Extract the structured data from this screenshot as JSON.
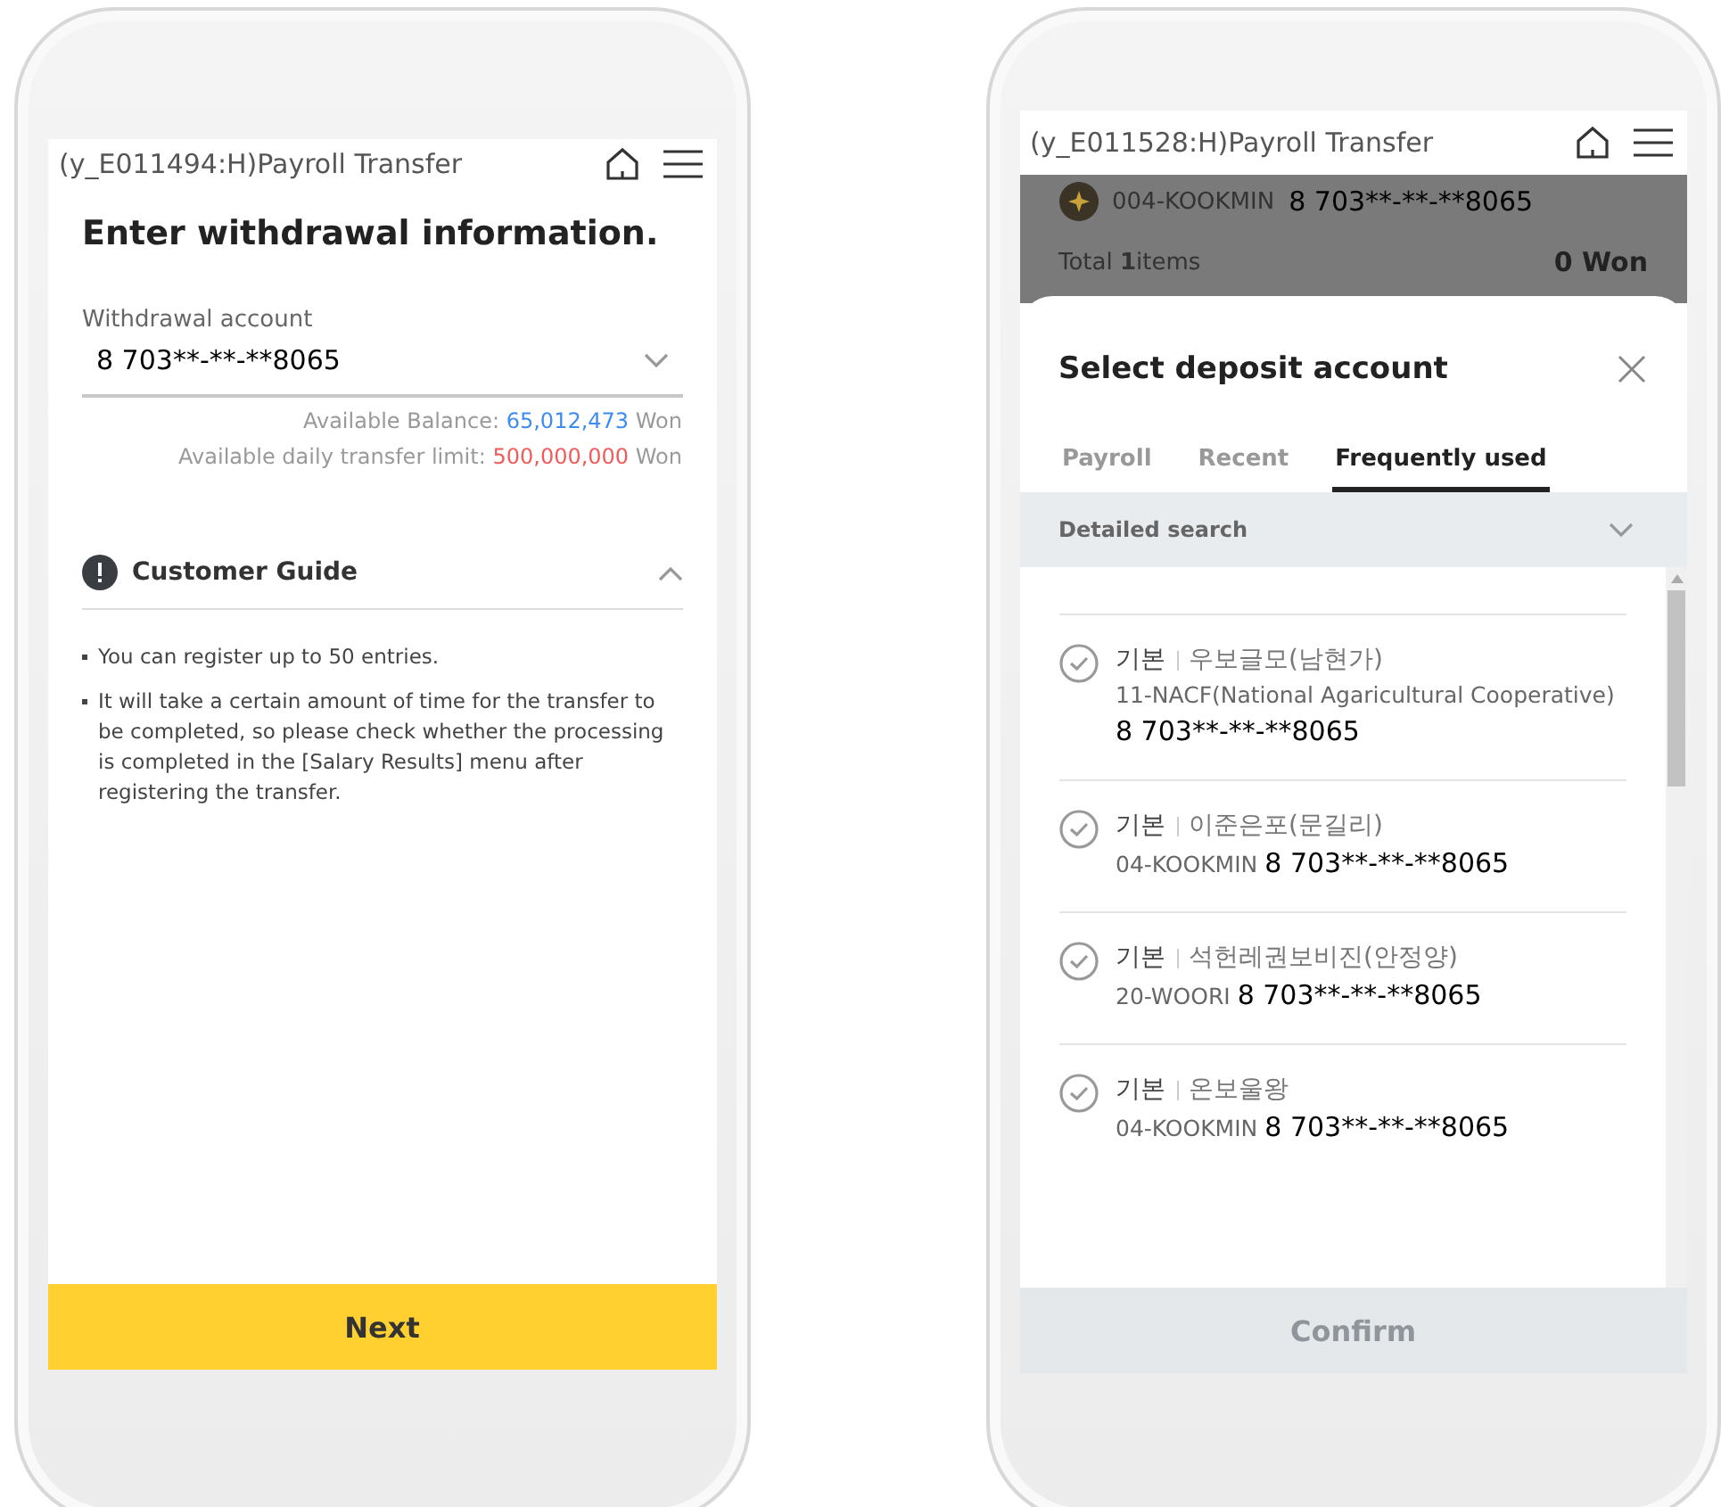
{
  "withdrawal_screen": {
    "header_title": "(y_E011494:H)Payroll Transfer",
    "title": "Enter withdrawal information.",
    "account_field": {
      "label": "Withdrawal account",
      "value": "8 703**-**-**8065"
    },
    "balance": {
      "label": "Available Balance:",
      "amount": "65,012,473",
      "unit": "Won"
    },
    "limit": {
      "label": "Available daily transfer limit:",
      "amount": "500,000,000",
      "unit": "Won"
    },
    "guide": {
      "title": "Customer Guide",
      "expanded": true,
      "items": [
        "You can register up to 50 entries.",
        "It will take a certain amount of time for the transfer to be completed, so please check whether the processing is completed in the [Salary Results] menu after registering the transfer."
      ]
    },
    "next_button": {
      "label": "Next",
      "disabled": false
    }
  },
  "deposit_screen": {
    "header_title": "(y_E011528:H)Payroll Transfer",
    "background": {
      "bank": "004-KOOKMIN",
      "account": "8 703**-**-**8065",
      "total": "Total **1**items",
      "amount": "0",
      "unit": "Won"
    },
    "sheet": {
      "title": "Select deposit account",
      "tabs": [
        {
          "label": "Payroll",
          "selected": false
        },
        {
          "label": "Recent",
          "selected": false
        },
        {
          "label": "Frequently used",
          "selected": true
        }
      ],
      "search": {
        "label": "Detailed search",
        "expanded": false
      },
      "accounts": [
        {
          "tag": "기본",
          "name": "우보글모(남현가)",
          "bank": "11-NACF(National Agaricultural Cooperative)",
          "number": "8 703**-**-**8065",
          "checked": false
        },
        {
          "tag": "기본",
          "name": "이준은포(문길리)",
          "bank": "04-KOOKMIN",
          "number": "8 703**-**-**8065",
          "checked": false
        },
        {
          "tag": "기본",
          "name": "석헌레권보비진(안정양)",
          "bank": "20-WOORI",
          "number": "8 703**-**-**8065",
          "checked": false
        },
        {
          "tag": "기본",
          "name": "온보울왕",
          "bank": "04-KOOKMIN",
          "number": "8 703**-**-**8065",
          "checked": false
        }
      ],
      "confirm_button": {
        "label": "Confirm",
        "disabled": true
      }
    }
  }
}
